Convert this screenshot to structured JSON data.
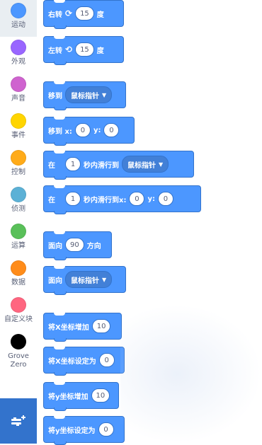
{
  "categories": [
    {
      "label": "运动",
      "color": "#4c97ff",
      "active": true
    },
    {
      "label": "外观",
      "color": "#9966ff"
    },
    {
      "label": "声音",
      "color": "#cf63cf"
    },
    {
      "label": "事件",
      "color": "#ffd500"
    },
    {
      "label": "控制",
      "color": "#ffab19"
    },
    {
      "label": "侦测",
      "color": "#5cb1d6"
    },
    {
      "label": "运算",
      "color": "#59c059"
    },
    {
      "label": "数据",
      "color": "#ff8c1a"
    },
    {
      "label": "自定义块",
      "color": "#ff6680"
    },
    {
      "label": "Grove Zero",
      "color": "#000000"
    }
  ],
  "extension_button": {
    "icon": "add-extension-icon",
    "color": "#3373cc"
  },
  "blocks": {
    "turn_right": {
      "label": "右转",
      "icon": "rotate-clockwise-icon",
      "value": "15",
      "unit": "度"
    },
    "turn_left": {
      "label": "左转",
      "icon": "rotate-counterclockwise-icon",
      "value": "15",
      "unit": "度"
    },
    "goto": {
      "label": "移到",
      "menu": "鼠标指针"
    },
    "goto_xy": {
      "label": "移到 x:",
      "x": "0",
      "ylabel": "y:",
      "y": "0"
    },
    "glide_to": {
      "label": "在",
      "secs": "1",
      "text": "秒内滑行到",
      "menu": "鼠标指针"
    },
    "glide_xy": {
      "label": "在",
      "secs": "1",
      "text": "秒内滑行到x:",
      "x": "0",
      "ylabel": "y:",
      "y": "0"
    },
    "point_dir": {
      "label": "面向",
      "value": "90",
      "unit": "方向"
    },
    "point_towards": {
      "label": "面向",
      "menu": "鼠标指针"
    },
    "change_x": {
      "label": "将X坐标增加",
      "value": "10"
    },
    "set_x": {
      "label": "将X坐标设定为",
      "value": "0"
    },
    "change_y": {
      "label": "将y坐标增加",
      "value": "10"
    },
    "set_y": {
      "label": "将y坐标设定为",
      "value": "0"
    }
  }
}
